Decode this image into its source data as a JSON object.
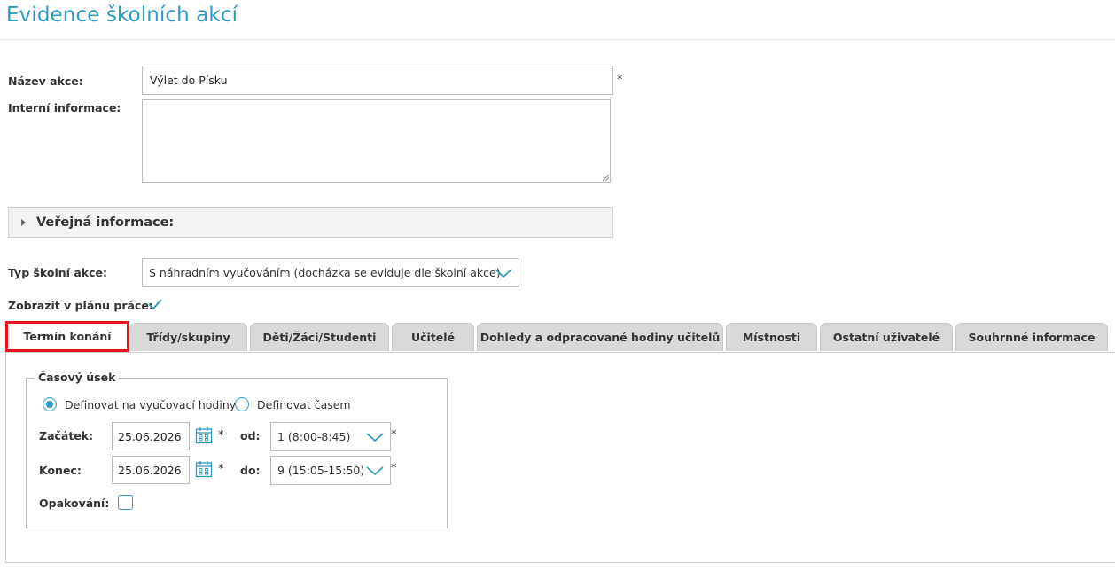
{
  "page": {
    "title": "Evidence školních akcí"
  },
  "form": {
    "name_label": "Název akce:",
    "name_value": "Výlet do Písku",
    "required_mark": "*",
    "internal_label": "Interní informace:",
    "internal_value": "",
    "public_panel_title": "Veřejná informace:",
    "type_label": "Typ školní akce:",
    "type_value": "S náhradním vyučováním (docházka se eviduje dle školní akce)",
    "show_in_plan_label": "Zobrazit v plánu práce:",
    "show_in_plan_checked": true
  },
  "tabs": [
    {
      "label": "Termín konání",
      "active": true
    },
    {
      "label": "Třídy/skupiny",
      "active": false
    },
    {
      "label": "Děti/Žáci/Studenti",
      "active": false
    },
    {
      "label": "Učitelé",
      "active": false
    },
    {
      "label": "Dohledy a odpracované hodiny učitelů",
      "active": false
    },
    {
      "label": "Místnosti",
      "active": false
    },
    {
      "label": "Ostatní uživatelé",
      "active": false
    },
    {
      "label": "Souhrnné informace",
      "active": false
    }
  ],
  "time_section": {
    "legend": "Časový úsek",
    "radio_lessons_label": "Definovat na vyučovací hodiny",
    "radio_time_label": "Definovat časem",
    "selected_mode": "lessons",
    "start_label": "Začátek:",
    "start_date": "25.06.2026",
    "from_label": "od:",
    "from_value": "1 (8:00-8:45)",
    "end_label": "Konec:",
    "end_date": "25.06.2026",
    "to_label": "do:",
    "to_value": "9 (15:05-15:50)",
    "repeat_label": "Opakování:",
    "repeat_checked": false
  },
  "colors": {
    "accent": "#2c9bc2",
    "highlight": "#e5131e",
    "tab_bg": "#d9d9d9"
  }
}
